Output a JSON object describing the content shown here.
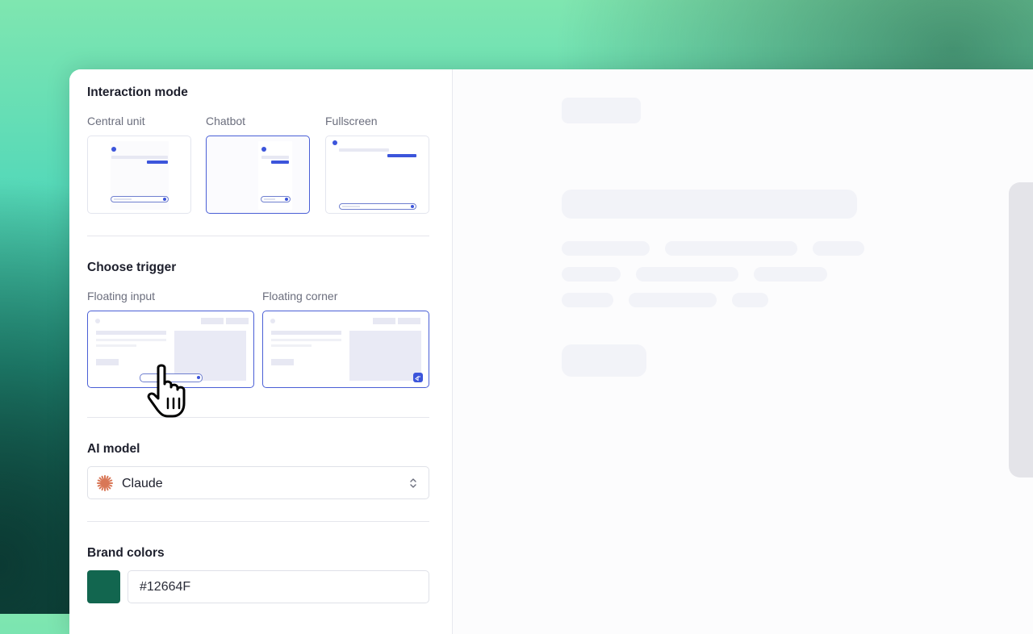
{
  "interaction_mode": {
    "title": "Interaction mode",
    "options": [
      {
        "label": "Central unit",
        "selected": false
      },
      {
        "label": "Chatbot",
        "selected": true
      },
      {
        "label": "Fullscreen",
        "selected": false
      }
    ]
  },
  "trigger": {
    "title": "Choose trigger",
    "options": [
      {
        "label": "Floating input",
        "selected": true
      },
      {
        "label": "Floating corner",
        "selected": true
      }
    ]
  },
  "ai_model": {
    "title": "AI model",
    "selected": "Claude",
    "icon": "claude-logo-icon"
  },
  "brand_colors": {
    "title": "Brand colors",
    "hex": "#12664F",
    "swatch_color": "#12664F"
  },
  "colors": {
    "accent": "#3C55DB",
    "claude_orange": "#D97757"
  }
}
